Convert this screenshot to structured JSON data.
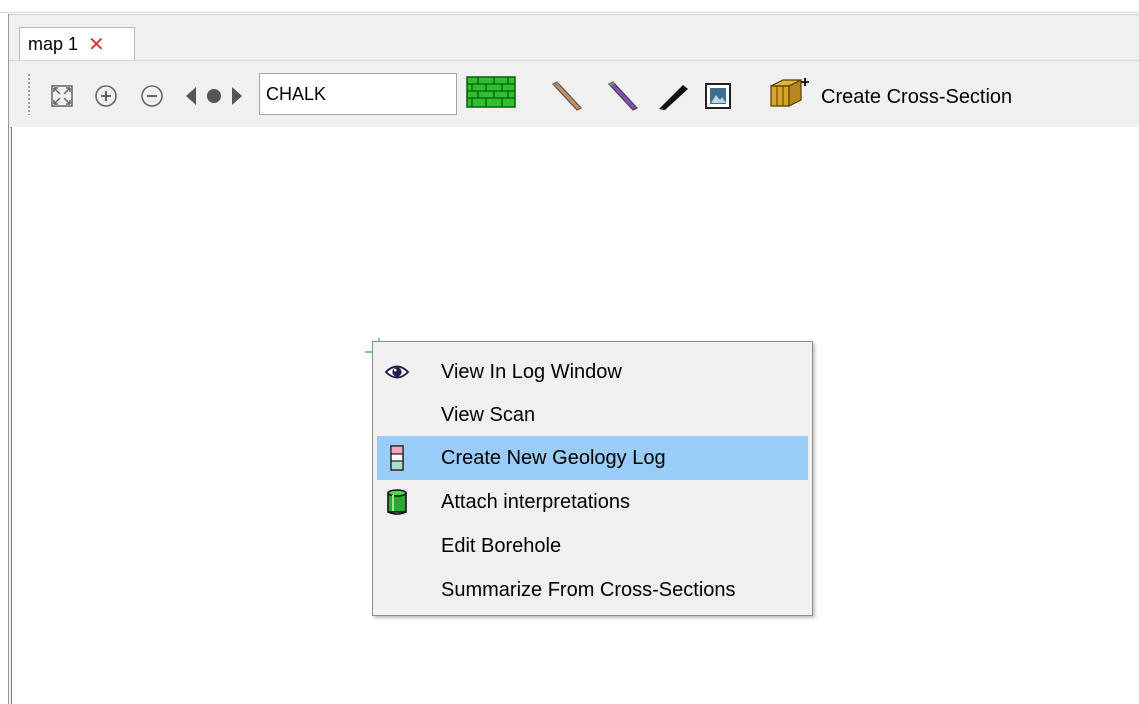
{
  "tab": {
    "label": "map 1",
    "close_symbol": "✕"
  },
  "toolbar": {
    "layer_value": "CHALK",
    "create_label": "Create Cross-Section",
    "icons": [
      "zoom-extents-icon",
      "zoom-in-icon",
      "zoom-out-icon",
      "pan-icon",
      "lithology-pattern-icon",
      "pen-icon",
      "pen-purple-icon",
      "pen-black-icon",
      "image-icon",
      "cross-section-icon"
    ]
  },
  "context_menu": {
    "items": [
      {
        "label": "View In Log Window",
        "icon": "eye-icon",
        "highlighted": false
      },
      {
        "label": "View Scan",
        "icon": "",
        "highlighted": false
      },
      {
        "label": "Create New Geology Log",
        "icon": "geology-log-icon",
        "highlighted": true
      },
      {
        "label": "Attach interpretations",
        "icon": "cylinder-icon",
        "highlighted": false
      },
      {
        "label": "Edit Borehole",
        "icon": "",
        "highlighted": false
      },
      {
        "label": "Summarize From Cross-Sections",
        "icon": "",
        "highlighted": false
      }
    ]
  },
  "colors": {
    "highlight": "#99ccf6",
    "close": "#e03131",
    "pattern_green": "#2fbf2f",
    "cursor": "#22c322"
  }
}
